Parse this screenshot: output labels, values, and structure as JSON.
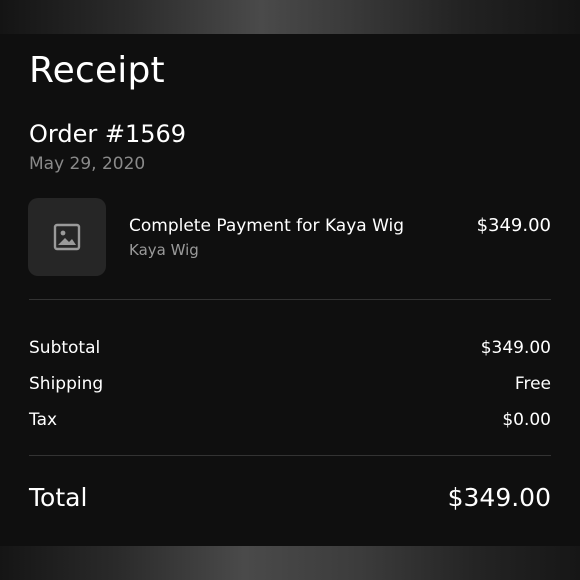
{
  "receipt": {
    "title": "Receipt",
    "order_number": "Order #1569",
    "order_date": "May 29, 2020"
  },
  "item": {
    "icon": "image-placeholder-icon",
    "name": "Complete Payment for Kaya Wig",
    "variant": "Kaya Wig",
    "price": "$349.00"
  },
  "summary": {
    "subtotal_label": "Subtotal",
    "subtotal_value": "$349.00",
    "shipping_label": "Shipping",
    "shipping_value": "Free",
    "tax_label": "Tax",
    "tax_value": "$0.00",
    "total_label": "Total",
    "total_value": "$349.00"
  },
  "colors": {
    "background": "#0f0f0f",
    "text_primary": "#ffffff",
    "text_secondary": "#8a8a8a",
    "thumbnail_bg": "#262626",
    "divider": "#333333"
  }
}
